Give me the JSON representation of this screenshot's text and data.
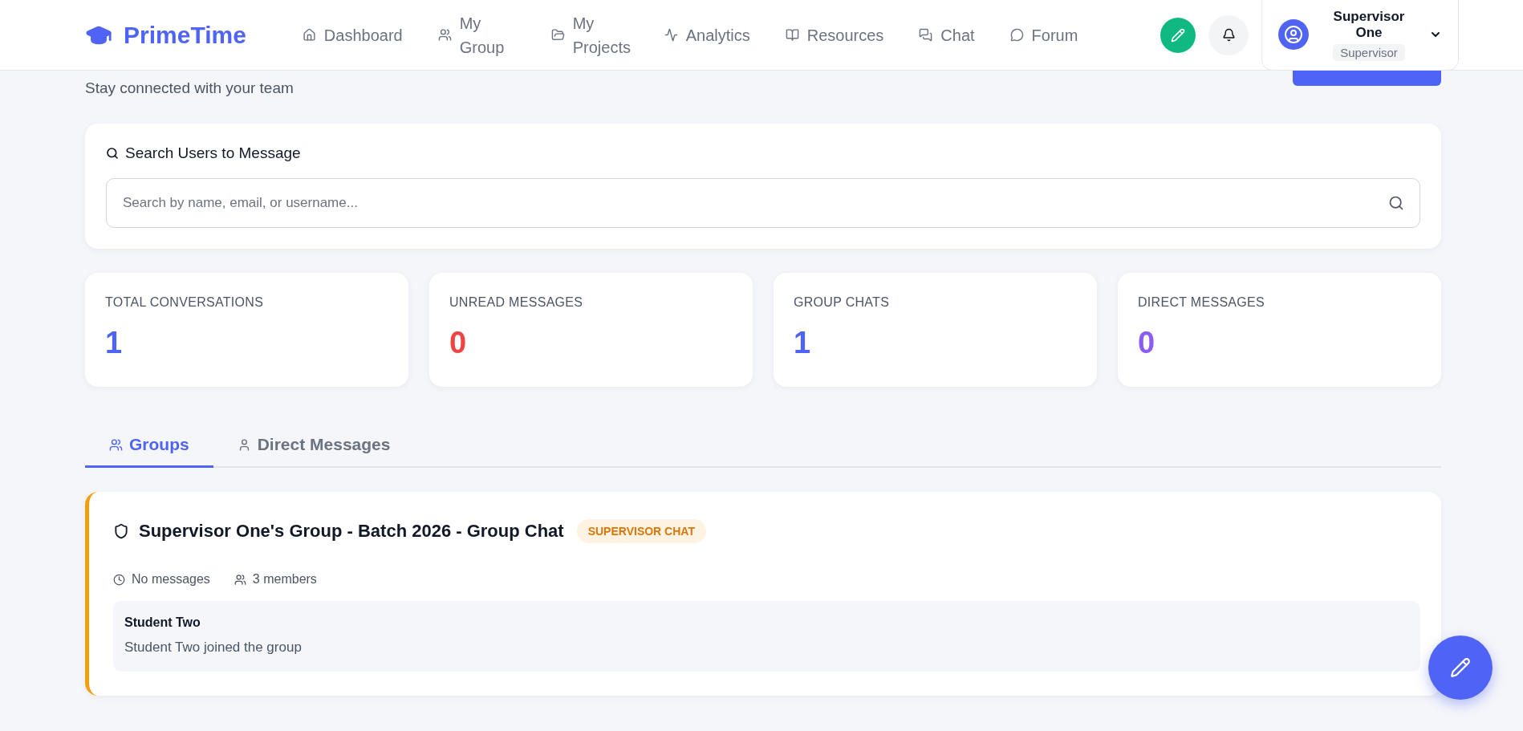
{
  "brand": "PrimeTime",
  "nav": [
    {
      "label": "Dashboard"
    },
    {
      "label": "My Group"
    },
    {
      "label": "My Projects"
    },
    {
      "label": "Analytics"
    },
    {
      "label": "Resources"
    },
    {
      "label": "Chat"
    },
    {
      "label": "Forum"
    }
  ],
  "user": {
    "name": "Supervisor One",
    "role": "Supervisor"
  },
  "subtitle": "Stay connected with your team",
  "search": {
    "title": "Search Users to Message",
    "placeholder": "Search by name, email, or username..."
  },
  "stats": [
    {
      "label": "TOTAL CONVERSATIONS",
      "value": "1",
      "color": "#4f63f5"
    },
    {
      "label": "UNREAD MESSAGES",
      "value": "0",
      "color": "#ef4444"
    },
    {
      "label": "GROUP CHATS",
      "value": "1",
      "color": "#4f63f5"
    },
    {
      "label": "DIRECT MESSAGES",
      "value": "0",
      "color": "#8b5cf6"
    }
  ],
  "tabs": [
    {
      "label": "Groups",
      "selected": true
    },
    {
      "label": "Direct Messages",
      "selected": false
    }
  ],
  "conversations": [
    {
      "title": "Supervisor One's Group - Batch 2026 - Group Chat",
      "badge": "SUPERVISOR CHAT",
      "last_activity": "No messages",
      "members": "3 members",
      "last_sender": "Student Two",
      "last_message": "Student Two joined the group"
    }
  ]
}
